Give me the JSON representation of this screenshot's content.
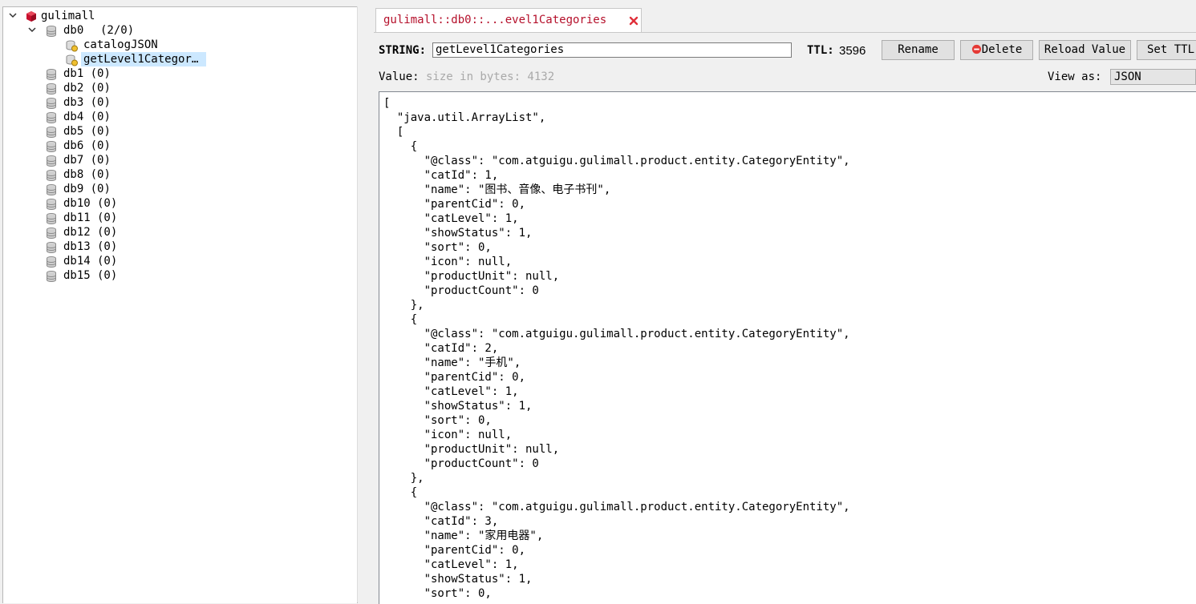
{
  "tree": {
    "connection": "gulimall",
    "db0": {
      "name": "db0",
      "count": "(2/0)"
    },
    "keys": [
      "catalogJSON",
      "getLevel1Categor…"
    ],
    "databases": [
      {
        "name": "db1",
        "count": "(0)"
      },
      {
        "name": "db2",
        "count": "(0)"
      },
      {
        "name": "db3",
        "count": "(0)"
      },
      {
        "name": "db4",
        "count": "(0)"
      },
      {
        "name": "db5",
        "count": "(0)"
      },
      {
        "name": "db6",
        "count": "(0)"
      },
      {
        "name": "db7",
        "count": "(0)"
      },
      {
        "name": "db8",
        "count": "(0)"
      },
      {
        "name": "db9",
        "count": "(0)"
      },
      {
        "name": "db10",
        "count": "(0)"
      },
      {
        "name": "db11",
        "count": "(0)"
      },
      {
        "name": "db12",
        "count": "(0)"
      },
      {
        "name": "db13",
        "count": "(0)"
      },
      {
        "name": "db14",
        "count": "(0)"
      },
      {
        "name": "db15",
        "count": "(0)"
      }
    ]
  },
  "tab": {
    "title": "gulimall::db0::...evel1Categories"
  },
  "key_view": {
    "type_label": "STRING:",
    "key_value": "getLevel1Categories",
    "ttl_label": "TTL:",
    "ttl_value": "3596",
    "rename_label": "Rename",
    "delete_label": "Delete",
    "reload_label": "Reload Value",
    "set_ttl_label": "Set TTL",
    "value_label": "Value:",
    "size_hint": "size in bytes: 4132",
    "view_as_label": "View as:",
    "view_as_value": "JSON"
  },
  "value_lines": [
    "[",
    "  \"java.util.ArrayList\",",
    "  [",
    "    {",
    "      \"@class\": \"com.atguigu.gulimall.product.entity.CategoryEntity\",",
    "      \"catId\": 1,",
    "      \"name\": \"图书、音像、电子书刊\",",
    "      \"parentCid\": 0,",
    "      \"catLevel\": 1,",
    "      \"showStatus\": 1,",
    "      \"sort\": 0,",
    "      \"icon\": null,",
    "      \"productUnit\": null,",
    "      \"productCount\": 0",
    "    },",
    "    {",
    "      \"@class\": \"com.atguigu.gulimall.product.entity.CategoryEntity\",",
    "      \"catId\": 2,",
    "      \"name\": \"手机\",",
    "      \"parentCid\": 0,",
    "      \"catLevel\": 1,",
    "      \"showStatus\": 1,",
    "      \"sort\": 0,",
    "      \"icon\": null,",
    "      \"productUnit\": null,",
    "      \"productCount\": 0",
    "    },",
    "    {",
    "      \"@class\": \"com.atguigu.gulimall.product.entity.CategoryEntity\",",
    "      \"catId\": 3,",
    "      \"name\": \"家用电器\",",
    "      \"parentCid\": 0,",
    "      \"catLevel\": 1,",
    "      \"showStatus\": 1,",
    "      \"sort\": 0,"
  ],
  "colors": {
    "tab_title": "#b5102b",
    "selection": "#cce8ff",
    "server_icon": "#c8102e",
    "hint_text": "#a9a9a9"
  }
}
